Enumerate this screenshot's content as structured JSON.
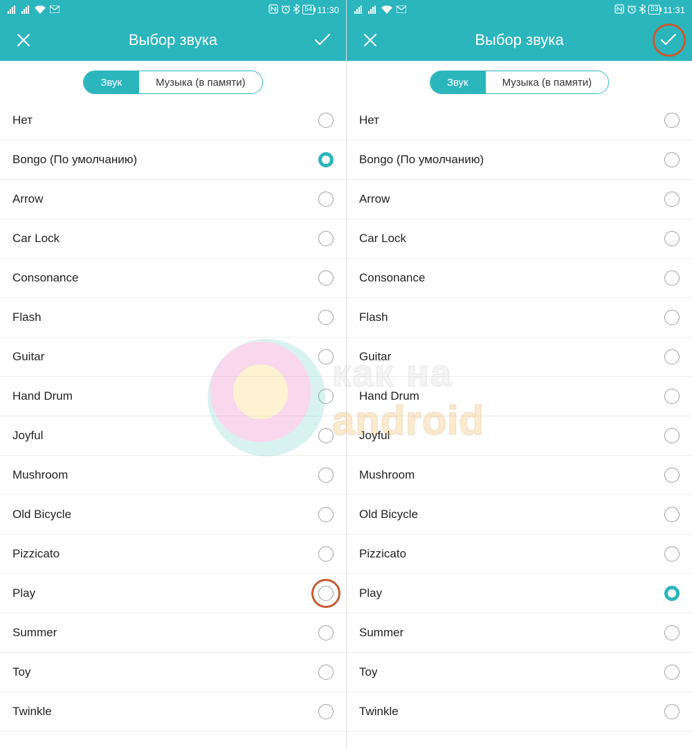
{
  "accent": "#2bb5bd",
  "highlight_color": "#c9592f",
  "screens": [
    {
      "status": {
        "battery": "54",
        "time": "11:30"
      },
      "header": {
        "title": "Выбор звука"
      },
      "tabs": {
        "active_label": "Звук",
        "other_label": "Музыка (в памяти)"
      },
      "selected_index": 1,
      "highlight": {
        "type": "radio",
        "index": 12
      },
      "items": [
        "Нет",
        "Bongo (По умолчанию)",
        "Arrow",
        "Car Lock",
        "Consonance",
        "Flash",
        "Guitar",
        "Hand Drum",
        "Joyful",
        "Mushroom",
        "Old Bicycle",
        "Pizzicato",
        "Play",
        "Summer",
        "Toy",
        "Twinkle"
      ]
    },
    {
      "status": {
        "battery": "53",
        "time": "11:31"
      },
      "header": {
        "title": "Выбор звука"
      },
      "tabs": {
        "active_label": "Звук",
        "other_label": "Музыка (в памяти)"
      },
      "selected_index": 12,
      "highlight": {
        "type": "confirm"
      },
      "items": [
        "Нет",
        "Bongo (По умолчанию)",
        "Arrow",
        "Car Lock",
        "Consonance",
        "Flash",
        "Guitar",
        "Hand Drum",
        "Joyful",
        "Mushroom",
        "Old Bicycle",
        "Pizzicato",
        "Play",
        "Summer",
        "Toy",
        "Twinkle"
      ]
    }
  ],
  "watermark": {
    "line1": "как на",
    "line2": "android"
  }
}
